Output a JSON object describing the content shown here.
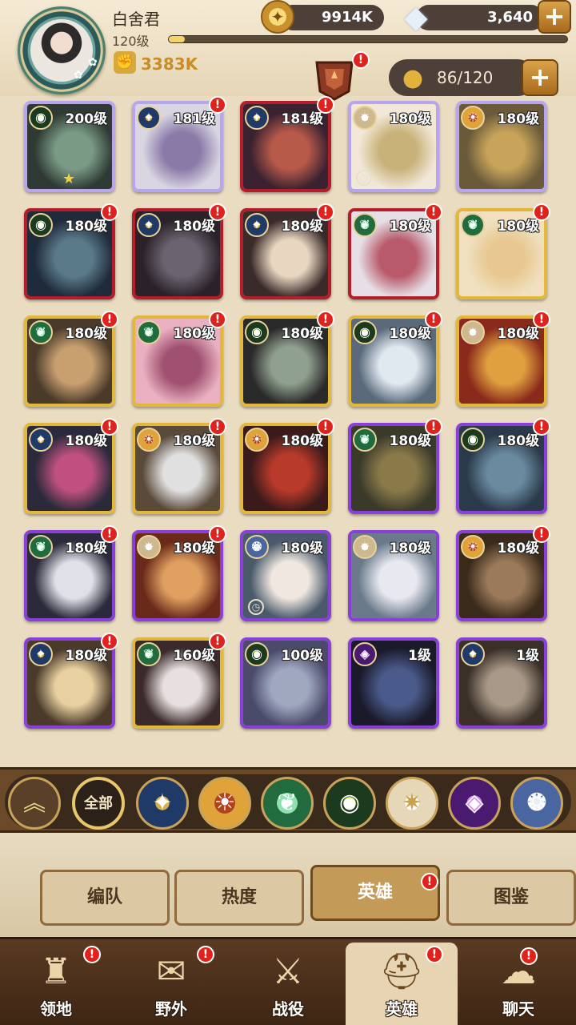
{
  "player": {
    "name": "白舍君",
    "level": "120级",
    "xp_fraction": 0.04,
    "power": "3383K"
  },
  "currency": {
    "gold": "9914K",
    "gems": "3,640"
  },
  "roster": {
    "count": "86/120"
  },
  "heroes": [
    {
      "level": "200级",
      "faction": "eye-icon",
      "border": "light",
      "star": true,
      "badge": false
    },
    {
      "level": "181级",
      "faction": "star-compass-icon",
      "border": "light",
      "badge": true
    },
    {
      "level": "181级",
      "faction": "star-compass-icon",
      "border": "red",
      "badge": true
    },
    {
      "level": "180级",
      "faction": "radiant-star-icon",
      "border": "light",
      "clock": true,
      "badge": false
    },
    {
      "level": "180级",
      "faction": "sun-emblem-icon",
      "border": "light",
      "badge": false
    },
    {
      "level": "180级",
      "faction": "eye-icon",
      "border": "red",
      "badge": true
    },
    {
      "level": "180级",
      "faction": "star-compass-icon",
      "border": "red",
      "badge": true
    },
    {
      "level": "180级",
      "faction": "star-compass-icon",
      "border": "red",
      "badge": true
    },
    {
      "level": "180级",
      "faction": "leaf-icon",
      "border": "red",
      "badge": true
    },
    {
      "level": "180级",
      "faction": "leaf-icon",
      "border": "gold",
      "badge": true
    },
    {
      "level": "180级",
      "faction": "leaf-icon",
      "border": "gold",
      "badge": true
    },
    {
      "level": "180级",
      "faction": "leaf-icon",
      "border": "gold",
      "badge": true
    },
    {
      "level": "180级",
      "faction": "eye-icon",
      "border": "gold",
      "badge": true
    },
    {
      "level": "180级",
      "faction": "eye-icon",
      "border": "gold",
      "badge": true
    },
    {
      "level": "180级",
      "faction": "radiant-star-icon",
      "border": "gold",
      "badge": true
    },
    {
      "level": "180级",
      "faction": "star-compass-icon",
      "border": "gold",
      "badge": true
    },
    {
      "level": "180级",
      "faction": "sun-emblem-icon",
      "border": "gold",
      "badge": true
    },
    {
      "level": "180级",
      "faction": "sun-emblem-icon",
      "border": "gold",
      "badge": true
    },
    {
      "level": "180级",
      "faction": "leaf-icon",
      "border": "violet",
      "badge": true
    },
    {
      "level": "180级",
      "faction": "eye-icon",
      "border": "violet",
      "badge": true
    },
    {
      "level": "180级",
      "faction": "leaf-icon",
      "border": "violet",
      "badge": true
    },
    {
      "level": "180级",
      "faction": "radiant-star-icon",
      "border": "violet",
      "badge": true
    },
    {
      "level": "180级",
      "faction": "moon-emblem-icon",
      "border": "violet",
      "clock": true,
      "badge": false
    },
    {
      "level": "180级",
      "faction": "radiant-star-icon",
      "border": "violet",
      "badge": false
    },
    {
      "level": "180级",
      "faction": "sun-emblem-icon",
      "border": "violet",
      "badge": true
    },
    {
      "level": "180级",
      "faction": "star-compass-icon",
      "border": "violet",
      "badge": true
    },
    {
      "level": "160级",
      "faction": "leaf-icon",
      "border": "gold",
      "badge": true
    },
    {
      "level": "100级",
      "faction": "eye-icon",
      "border": "violet",
      "badge": false
    },
    {
      "level": "1级",
      "faction": "dark-icon",
      "border": "violet",
      "badge": false
    },
    {
      "level": "1级",
      "faction": "star-compass-icon",
      "border": "violet",
      "badge": false
    }
  ],
  "filters": {
    "all_label": "全部"
  },
  "subtabs": [
    {
      "label": "编队"
    },
    {
      "label": "热度"
    },
    {
      "label": "英雄"
    },
    {
      "label": "图鉴"
    }
  ],
  "nav": [
    {
      "label": "领地"
    },
    {
      "label": "野外"
    },
    {
      "label": "战役"
    },
    {
      "label": "英雄"
    },
    {
      "label": "聊天"
    }
  ],
  "colors": {
    "background": "#e9dcc0",
    "badge_red": "#e0221c",
    "gold_accent": "#e2b73c",
    "violet_border": "#8a40d8"
  }
}
